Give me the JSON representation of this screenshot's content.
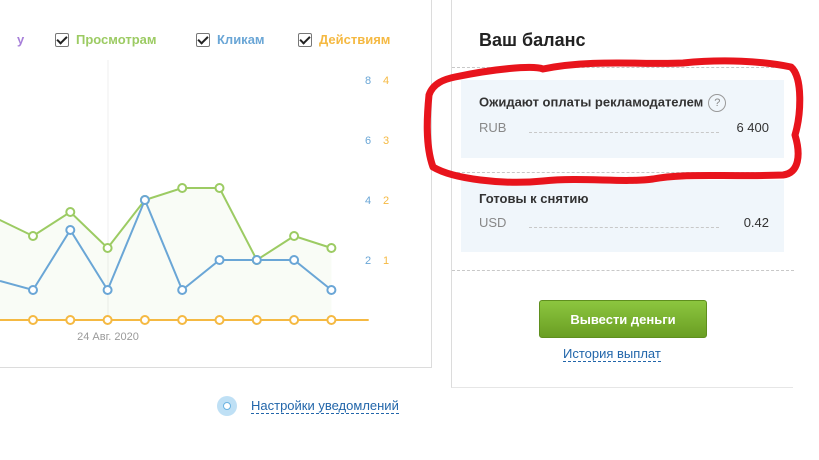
{
  "legend": [
    {
      "label": "у",
      "color": "#a77fd9",
      "checkbox": false
    },
    {
      "label": "Просмотрам",
      "color": "#9ccb63",
      "checkbox": true
    },
    {
      "label": "Кликам",
      "color": "#6aa6d6",
      "checkbox": true
    },
    {
      "label": "Действиям",
      "color": "#f5b942",
      "checkbox": true
    }
  ],
  "chart_data": {
    "type": "line",
    "x_tick_label": "24 Авг. 2020",
    "y_left_ticks": [
      "8",
      "6",
      "4",
      "2"
    ],
    "y_right_ticks": [
      "4",
      "3",
      "2",
      "1"
    ],
    "y_left_color": "#6aa6d6",
    "y_right_color": "#f5b942",
    "ylim_left": [
      0,
      8
    ],
    "ylim_right": [
      0,
      4
    ],
    "series": [
      {
        "name": "Просмотрам",
        "axis": "left",
        "color": "#9ccb63",
        "values": [
          3.4,
          2.8,
          3.6,
          2.4,
          4.0,
          4.4,
          4.4,
          2.0,
          2.8,
          2.4
        ]
      },
      {
        "name": "Кликам",
        "axis": "left",
        "color": "#6aa6d6",
        "values": [
          1.0,
          3.0,
          1.0,
          4.0,
          1.0,
          2.0,
          2.0,
          2.0,
          1.0
        ]
      },
      {
        "name": "Действиям",
        "axis": "right",
        "color": "#f5b942",
        "values": [
          0,
          0,
          0,
          0,
          0,
          0,
          0,
          0,
          0,
          0,
          0
        ]
      }
    ]
  },
  "balance": {
    "title": "Ваш баланс",
    "pending": {
      "title": "Ожидают оплаты рекламодателем",
      "help": "?",
      "currency": "RUB",
      "amount": "6 400"
    },
    "ready": {
      "title": "Готовы к снятию",
      "currency": "USD",
      "amount": "0.42"
    },
    "withdraw_label": "Вывести деньги",
    "history_label": "История выплат"
  },
  "notifications_label": "Настройки уведомлений",
  "colors": {
    "accent_green": "#7ab32e",
    "link": "#2266aa",
    "annotation": "#e8141c"
  }
}
